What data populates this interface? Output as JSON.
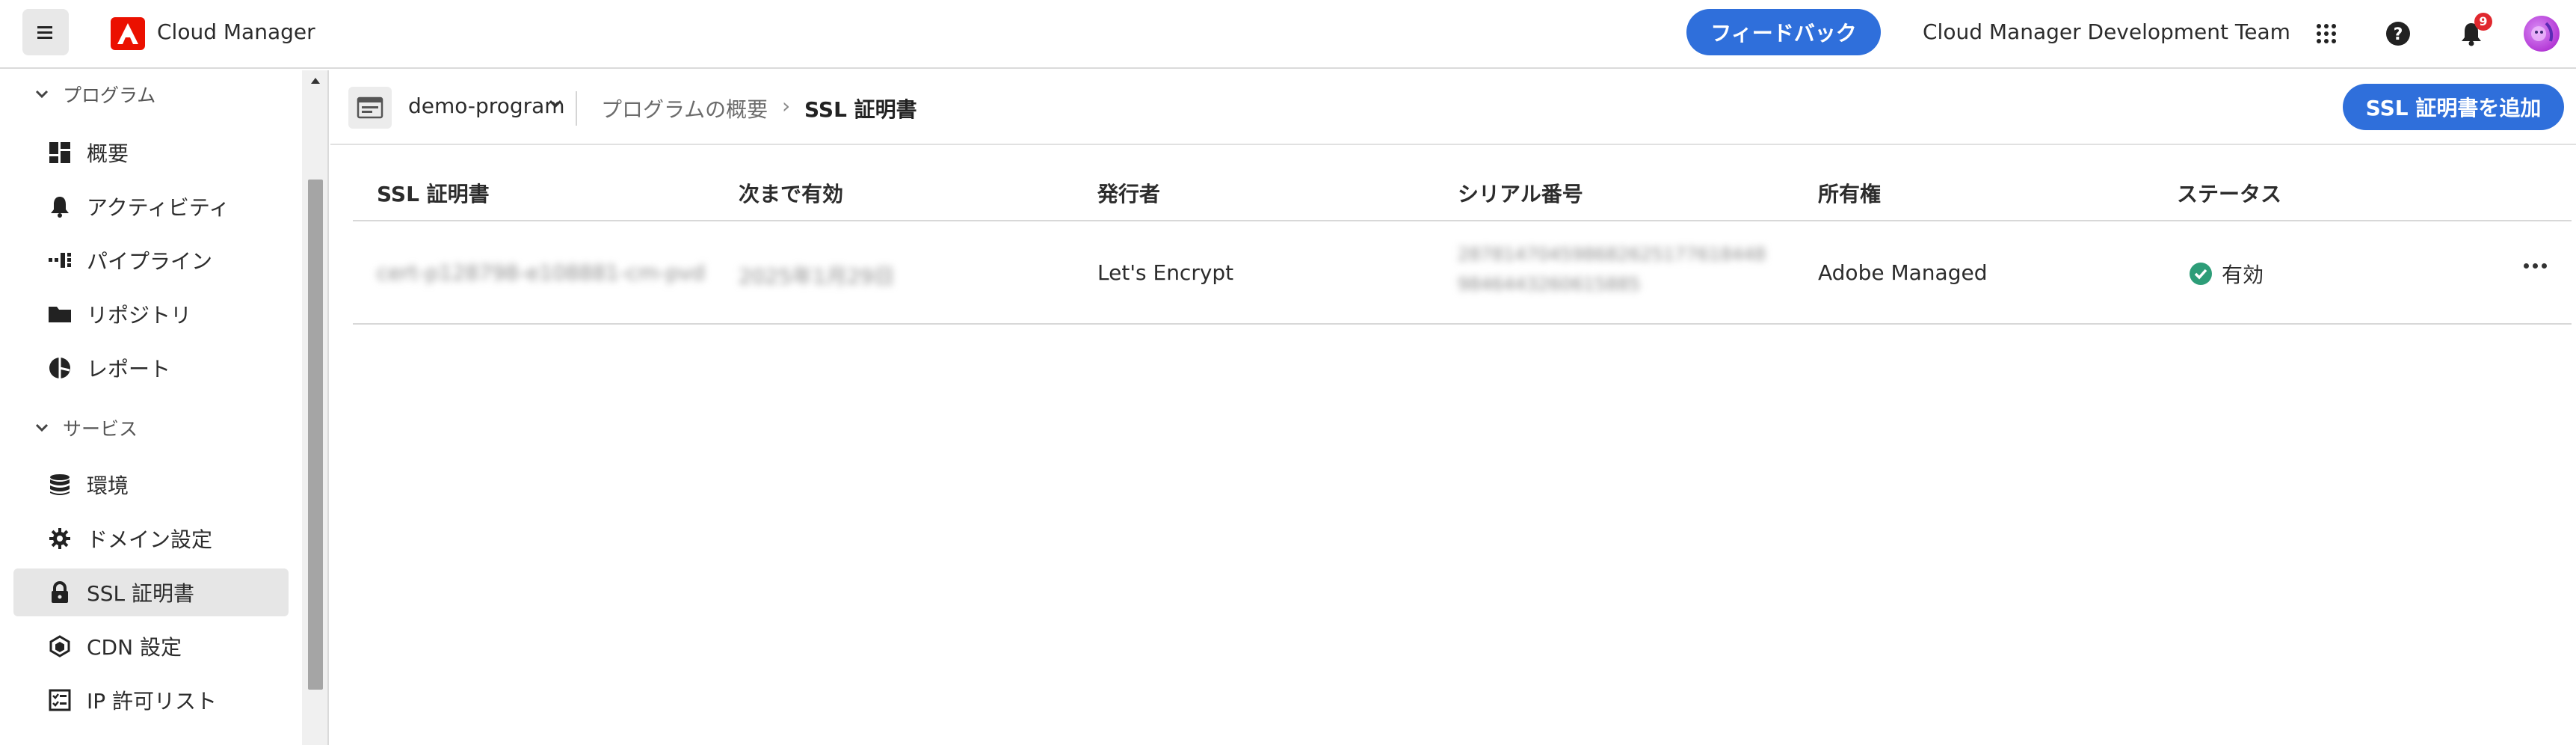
{
  "header": {
    "app_title": "Cloud Manager",
    "feedback_label": "フィードバック",
    "org_name": "Cloud Manager Development Team",
    "notification_count": "9"
  },
  "sidebar": {
    "sections": [
      {
        "label": "プログラム",
        "items": [
          {
            "label": "概要",
            "icon": "overview-icon"
          },
          {
            "label": "アクティビティ",
            "icon": "bell-icon"
          },
          {
            "label": "パイプライン",
            "icon": "pipeline-icon"
          },
          {
            "label": "リポジトリ",
            "icon": "folder-icon"
          },
          {
            "label": "レポート",
            "icon": "report-icon"
          }
        ]
      },
      {
        "label": "サービス",
        "items": [
          {
            "label": "環境",
            "icon": "database-icon"
          },
          {
            "label": "ドメイン設定",
            "icon": "gear-icon"
          },
          {
            "label": "SSL 証明書",
            "icon": "lock-icon",
            "active": true
          },
          {
            "label": "CDN 設定",
            "icon": "cdn-icon"
          },
          {
            "label": "IP 許可リスト",
            "icon": "checklist-icon"
          }
        ]
      }
    ]
  },
  "subheader": {
    "program_name": "demo-program",
    "breadcrumb_parent": "プログラムの概要",
    "breadcrumb_separator": "›",
    "breadcrumb_current": "SSL 証明書",
    "add_button_label": "SSL 証明書を追加"
  },
  "table": {
    "columns": [
      "SSL 証明書",
      "次まで有効",
      "発行者",
      "シリアル番号",
      "所有権",
      "ステータス"
    ],
    "rows": [
      {
        "certificate": "cert-p128798-e108881-cm-pvd",
        "valid_until": "2025年1月29日",
        "issuer": "Let's Encrypt",
        "serial_line1": "287814704598682625177618448",
        "serial_line2": "9846443260615885",
        "ownership": "Adobe Managed",
        "status": "有効"
      }
    ]
  },
  "colors": {
    "accent": "#2f6fdb",
    "status_ok": "#2d9d78",
    "badge": "#e0282e"
  }
}
